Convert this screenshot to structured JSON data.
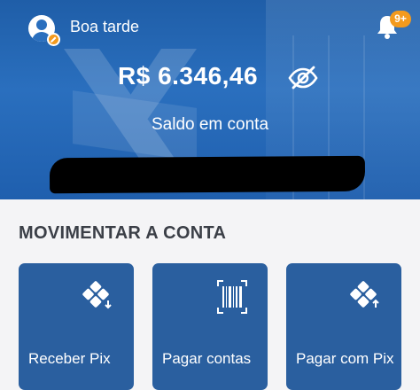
{
  "header": {
    "greeting": "Boa tarde",
    "notification_badge": "9+"
  },
  "balance": {
    "amount": "R$ 6.346,46",
    "label": "Saldo em conta"
  },
  "section": {
    "title": "MOVIMENTAR A CONTA"
  },
  "actions": [
    {
      "label": "Receber Pix",
      "icon": "pix-receive-icon"
    },
    {
      "label": "Pagar contas",
      "icon": "barcode-icon"
    },
    {
      "label": "Pagar com Pix",
      "icon": "pix-send-icon"
    }
  ],
  "colors": {
    "hero_blue": "#2a6fbe",
    "card_blue": "#2a5f9f",
    "accent_orange": "#f39a1e"
  }
}
